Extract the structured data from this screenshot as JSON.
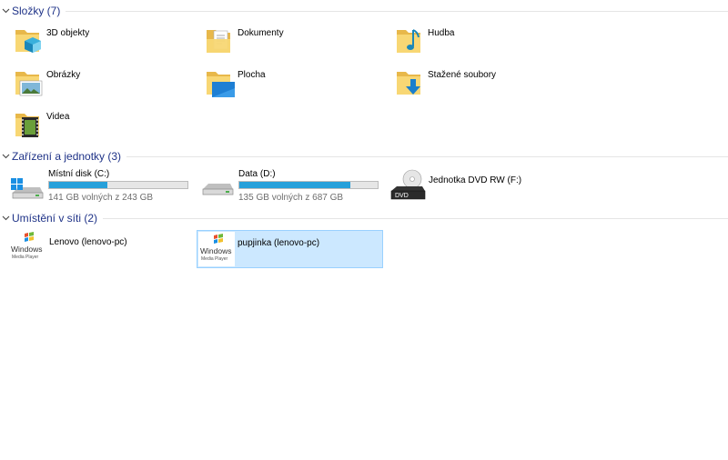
{
  "groups": {
    "folders": {
      "title": "Složky (7)"
    },
    "devices": {
      "title": "Zařízení a jednotky (3)"
    },
    "network": {
      "title": "Umístění v síti (2)"
    }
  },
  "folders": [
    {
      "label": "3D objekty",
      "icon": "3d-objects-folder-icon"
    },
    {
      "label": "Dokumenty",
      "icon": "documents-folder-icon"
    },
    {
      "label": "Hudba",
      "icon": "music-folder-icon"
    },
    {
      "label": "Obrázky",
      "icon": "pictures-folder-icon"
    },
    {
      "label": "Plocha",
      "icon": "desktop-folder-icon"
    },
    {
      "label": "Stažené soubory",
      "icon": "downloads-folder-icon"
    },
    {
      "label": "Videa",
      "icon": "videos-folder-icon"
    }
  ],
  "drives": [
    {
      "label": "Místní disk (C:)",
      "free_text": "141 GB volných z 243 GB",
      "used_fraction": 0.42,
      "icon": "windows-drive-icon"
    },
    {
      "label": "Data (D:)",
      "free_text": "135 GB volných z 687 GB",
      "used_fraction": 0.8,
      "icon": "hard-drive-icon"
    },
    {
      "label": "Jednotka DVD RW (F:)",
      "icon": "dvd-drive-icon",
      "dvd_text": "DVD"
    }
  ],
  "network": [
    {
      "label": "Lenovo (lenovo-pc)",
      "icon": "windows-media-player-icon",
      "selected": false
    },
    {
      "label": "pupjinka (lenovo-pc)",
      "icon": "windows-media-player-icon",
      "selected": true
    }
  ],
  "wmp_logo": {
    "line1": "Windows",
    "line2": "Media Player"
  },
  "colors": {
    "accent": "#26a0da",
    "header": "#1e3287",
    "selection": "#cce8ff",
    "selection_border": "#99d1ff"
  }
}
